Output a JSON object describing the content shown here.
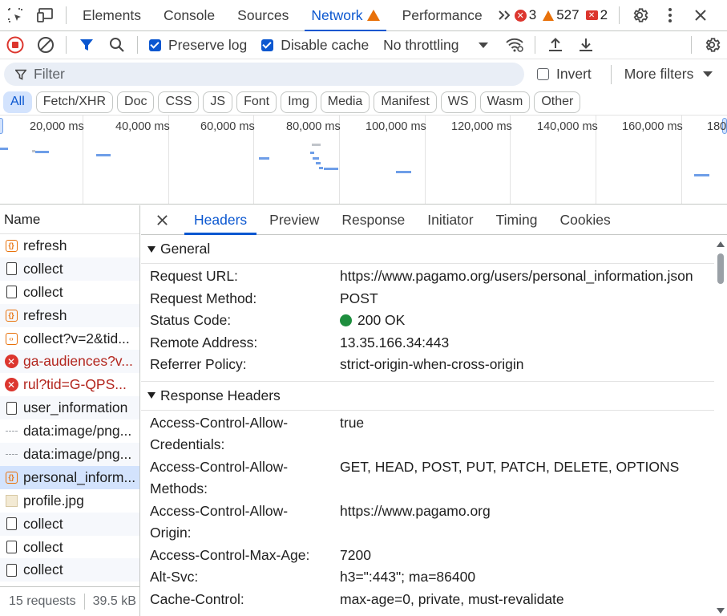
{
  "tabs": {
    "items": [
      "Elements",
      "Console",
      "Sources",
      "Network",
      "Performance"
    ],
    "active": "Network",
    "errors": "3",
    "warnings": "527",
    "issues": "2"
  },
  "toolbar": {
    "preserve_log": "Preserve log",
    "disable_cache": "Disable cache",
    "throttling": "No throttling"
  },
  "filter": {
    "placeholder": "Filter",
    "invert": "Invert",
    "more_filters": "More filters"
  },
  "chips": [
    "All",
    "Fetch/XHR",
    "Doc",
    "CSS",
    "JS",
    "Font",
    "Img",
    "Media",
    "Manifest",
    "WS",
    "Wasm",
    "Other"
  ],
  "overview": {
    "ticks": [
      "20,000 ms",
      "40,000 ms",
      "60,000 ms",
      "80,000 ms",
      "100,000 ms",
      "120,000 ms",
      "140,000 ms",
      "160,000 ms",
      "180"
    ]
  },
  "requests": {
    "header": "Name",
    "items": [
      {
        "name": "refresh",
        "icon": "xhr-icon",
        "state": "normal"
      },
      {
        "name": "collect",
        "icon": "document-icon",
        "state": "normal"
      },
      {
        "name": "collect",
        "icon": "document-icon",
        "state": "normal"
      },
      {
        "name": "refresh",
        "icon": "xhr-icon",
        "state": "normal"
      },
      {
        "name": "collect?v=2&tid...",
        "icon": "script-icon",
        "state": "normal"
      },
      {
        "name": "ga-audiences?v...",
        "icon": "error-icon",
        "state": "error"
      },
      {
        "name": "rul?tid=G-QPS...",
        "icon": "error-icon",
        "state": "error"
      },
      {
        "name": "user_information",
        "icon": "document-icon",
        "state": "normal"
      },
      {
        "name": "data:image/png...",
        "icon": "data-icon",
        "state": "normal"
      },
      {
        "name": "data:image/png...",
        "icon": "data-icon",
        "state": "normal"
      },
      {
        "name": "personal_inform...",
        "icon": "xhr-icon",
        "state": "selected"
      },
      {
        "name": "profile.jpg",
        "icon": "image-icon",
        "state": "normal"
      },
      {
        "name": "collect",
        "icon": "document-icon",
        "state": "normal"
      },
      {
        "name": "collect",
        "icon": "document-icon",
        "state": "normal"
      },
      {
        "name": "collect",
        "icon": "document-icon",
        "state": "normal"
      }
    ],
    "count": "15 requests",
    "transferred": "39.5 kB"
  },
  "detail": {
    "tabs": [
      "Headers",
      "Preview",
      "Response",
      "Initiator",
      "Timing",
      "Cookies"
    ],
    "active_tab": "Headers",
    "general": {
      "title": "General",
      "rows": [
        {
          "key": "Request URL:",
          "value": "https://www.pagamo.org/users/personal_information.json"
        },
        {
          "key": "Request Method:",
          "value": "POST"
        },
        {
          "key": "Status Code:",
          "value": "200 OK"
        },
        {
          "key": "Remote Address:",
          "value": "13.35.166.34:443"
        },
        {
          "key": "Referrer Policy:",
          "value": "strict-origin-when-cross-origin"
        }
      ]
    },
    "response_headers": {
      "title": "Response Headers",
      "rows": [
        {
          "key1": "Access-Control-Allow-",
          "key2": "Credentials:",
          "value": "true"
        },
        {
          "key1": "Access-Control-Allow-",
          "key2": "Methods:",
          "value": "GET, HEAD, POST, PUT, PATCH, DELETE, OPTIONS"
        },
        {
          "key1": "Access-Control-Allow-",
          "key2": "Origin:",
          "value": "https://www.pagamo.org"
        },
        {
          "key1": "Access-Control-Max-Age:",
          "key2": "",
          "value": "7200"
        },
        {
          "key1": "Alt-Svc:",
          "key2": "",
          "value": "h3=\":443\"; ma=86400"
        },
        {
          "key1": "Cache-Control:",
          "key2": "",
          "value": "max-age=0, private, must-revalidate"
        }
      ]
    }
  },
  "colors": {
    "accent": "#0b57d0",
    "error": "#dc362e",
    "warning": "#e8710a",
    "status_ok": "#1e8e3e",
    "selected_row": "#d3e3fd"
  }
}
